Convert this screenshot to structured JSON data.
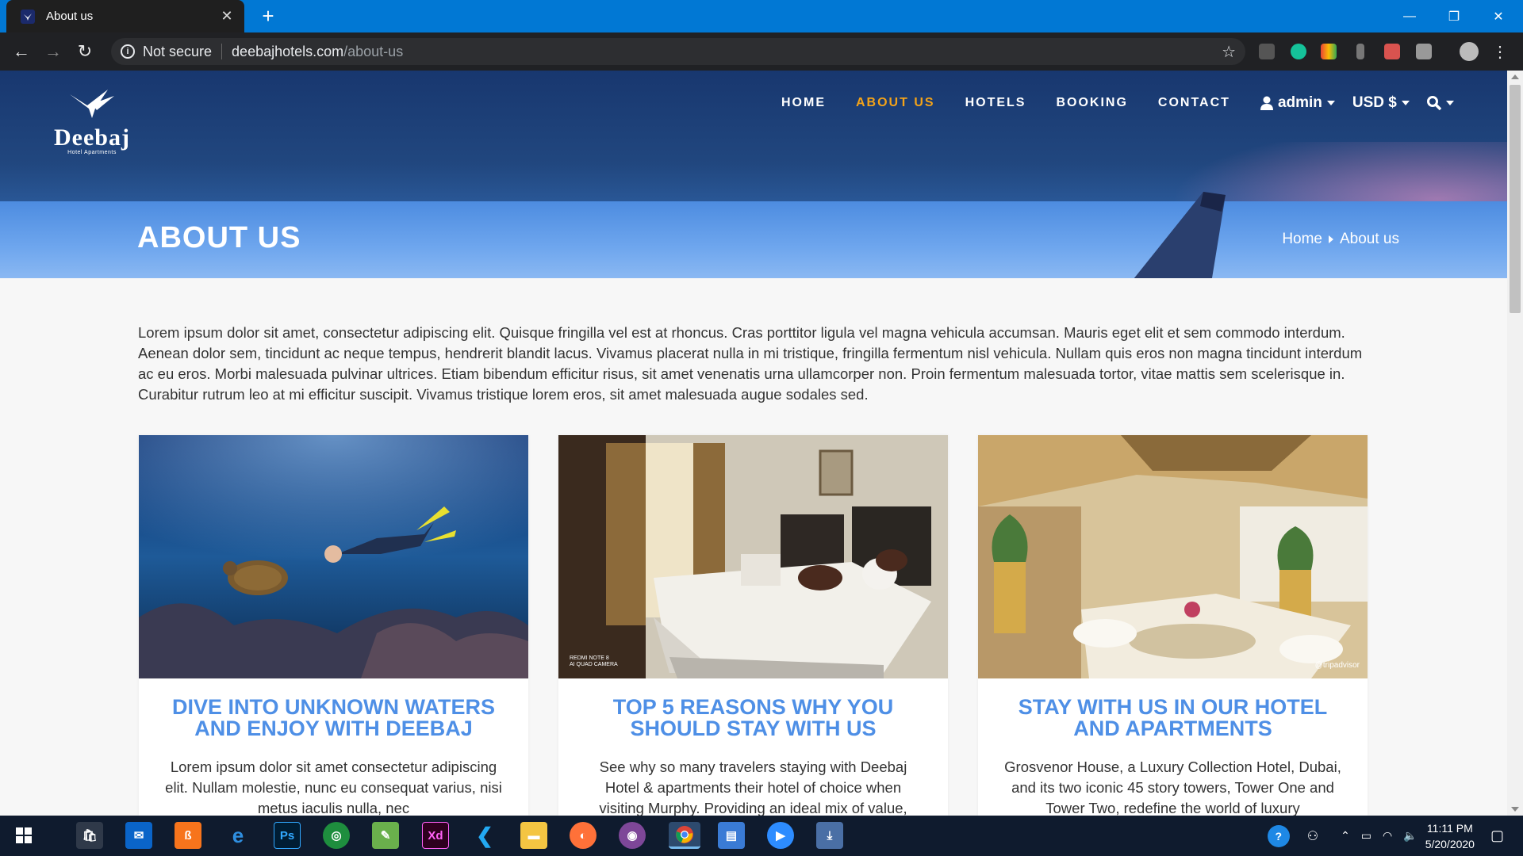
{
  "browser": {
    "tab_title": "About us",
    "new_tab": "+",
    "url_security": "Not secure",
    "url_host": "deebajhotels.com",
    "url_path": "/about-us"
  },
  "site": {
    "logo_name": "Deebaj",
    "logo_sub": "Hotel Apartments",
    "nav": [
      "HOME",
      "ABOUT US",
      "HOTELS",
      "BOOKING",
      "CONTACT"
    ],
    "active_nav": "ABOUT US",
    "user": "admin",
    "currency": "USD $",
    "page_title": "ABOUT US",
    "breadcrumb": [
      "Home",
      "About us"
    ]
  },
  "intro": "Lorem ipsum dolor sit amet, consectetur adipiscing elit. Quisque fringilla vel est at rhoncus. Cras porttitor ligula vel magna vehicula accumsan. Mauris eget elit et sem commodo interdum. Aenean dolor sem, tincidunt ac neque tempus, hendrerit blandit lacus. Vivamus placerat nulla in mi tristique, fringilla fermentum nisl vehicula. Nullam quis eros non magna tincidunt interdum ac eu eros. Morbi malesuada pulvinar ultrices. Etiam bibendum efficitur risus, sit amet venenatis urna ullamcorper non. Proin fermentum malesuada tortor, vitae mattis sem scelerisque in. Curabitur rutrum leo at mi efficitur suscipit. Vivamus tristique lorem eros, sit amet malesuada augue sodales sed.",
  "cards": [
    {
      "title": "DIVE INTO UNKNOWN WATERS AND ENJOY WITH DEEBAJ",
      "text": "Lorem ipsum dolor sit amet consectetur adipiscing elit. Nullam molestie, nunc eu consequat varius, nisi metus iaculis nulla, nec"
    },
    {
      "title": "TOP 5 REASONS WHY YOU SHOULD STAY WITH US",
      "text": "See why so many travelers staying with Deebaj Hotel & apartments their hotel of choice when visiting Murphy. Providing an ideal mix of value,",
      "watermark": "REDMI NOTE 8\nAI QUAD CAMERA"
    },
    {
      "title": "STAY WITH US IN OUR HOTEL AND APARTMENTS",
      "text": "Grosvenor House, a Luxury Collection Hotel, Dubai, and its two iconic 45 story towers, Tower One and Tower Two, redefine the world of luxury",
      "watermark": "@tripadvisor"
    }
  ],
  "taskbar": {
    "time": "11:11 PM",
    "date": "5/20/2020",
    "icons": [
      "windows-start",
      "store",
      "mail",
      "xampp",
      "edge",
      "photoshop",
      "maps",
      "notepad",
      "adobe-xd",
      "vscode",
      "file-explorer",
      "firefox",
      "tor",
      "chrome",
      "control-panel",
      "zoom",
      "downloads"
    ]
  },
  "colors": {
    "tabbar": "#0178d4",
    "nav_active": "#f4a318",
    "card_title": "#4e8fe6"
  }
}
